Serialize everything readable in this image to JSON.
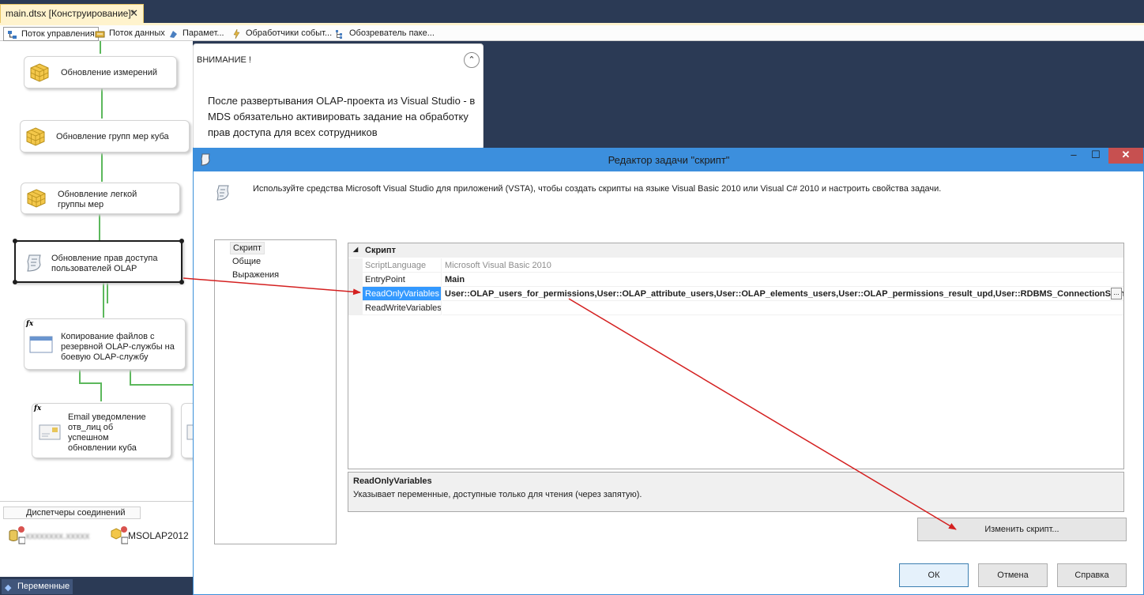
{
  "document_tab": {
    "title": "main.dtsx [Конструирование]*",
    "close": "✕"
  },
  "designer_tabs": [
    {
      "label": "Поток управления",
      "icon": "control-flow-icon",
      "active": true
    },
    {
      "label": "Поток данных",
      "icon": "data-flow-icon",
      "active": false
    },
    {
      "label": "Парамет...",
      "icon": "parameters-icon",
      "active": false
    },
    {
      "label": "Обработчики событ...",
      "icon": "event-handlers-icon",
      "active": false
    },
    {
      "label": "Обозреватель паке...",
      "icon": "package-explorer-icon",
      "active": false
    }
  ],
  "tasks": [
    {
      "label": "Обновление измерений",
      "icon": "cube-icon"
    },
    {
      "label": "Обновление групп мер куба",
      "icon": "cube-icon"
    },
    {
      "label": "Обновление легкой группы мер",
      "icon": "cube-icon"
    },
    {
      "label": "Обновление прав доступа пользователей OLAP",
      "icon": "script-icon",
      "selected": true
    },
    {
      "label": "Копирование файлов с резервной OLAP-службы на боевую OLAP-службу",
      "icon": "window-icon",
      "badge": "fx"
    },
    {
      "label": "Email уведомление отв_лиц об успешном обновлении куба",
      "icon": "mail-icon",
      "badge": "fx"
    }
  ],
  "annotation": {
    "title": "ВНИМАНИЕ !",
    "text": "После развертывания OLAP-проекта из Visual Studio - в MDS обязательно активировать задание на обработку прав доступа для всех сотрудников",
    "collapse_icon": "⌃"
  },
  "connections": {
    "tab_label": "Диспетчеры соединений",
    "items": [
      {
        "label": "",
        "icon": "db-connection-icon",
        "obscured": true
      },
      {
        "label": "MSOLAP2012",
        "icon": "olap-connection-icon"
      }
    ]
  },
  "status": {
    "variables_tab": "Переменные"
  },
  "dialog": {
    "title": "Редактор задачи \"скрипт\"",
    "window_buttons": {
      "minimize": "‒",
      "maximize": "☐",
      "close": "✕"
    },
    "intro": "Используйте средства Microsoft Visual Studio для приложений (VSTA), чтобы создать скрипты на языке Visual Basic 2010 или Visual C# 2010 и настроить свойства задачи.",
    "pages": [
      "Скрипт",
      "Общие",
      "Выражения"
    ],
    "grid": {
      "category": "Скрипт",
      "rows": [
        {
          "name": "ScriptLanguage",
          "value": "Microsoft Visual Basic 2010"
        },
        {
          "name": "EntryPoint",
          "value": "Main"
        },
        {
          "name": "ReadOnlyVariables",
          "value": "User::OLAP_users_for_permissions,User::OLAP_attribute_users,User::OLAP_elements_users,User::OLAP_permissions_result_upd,User::RDBMS_ConnectionString"
        },
        {
          "name": "ReadWriteVariables",
          "value": ""
        }
      ],
      "ellipsis": "..."
    },
    "description": {
      "title": "ReadOnlyVariables",
      "text": "Указывает переменные, доступные только для чтения (через запятую)."
    },
    "edit_script_button": "Изменить скрипт...",
    "buttons": {
      "ok": "ОК",
      "cancel": "Отмена",
      "help": "Справка"
    }
  },
  "colors": {
    "accent": "#3c8fdd",
    "selection": "#3399ff",
    "connector": "#5cb85c",
    "annotation_arrow": "#d42020",
    "close_button": "#c75050"
  }
}
